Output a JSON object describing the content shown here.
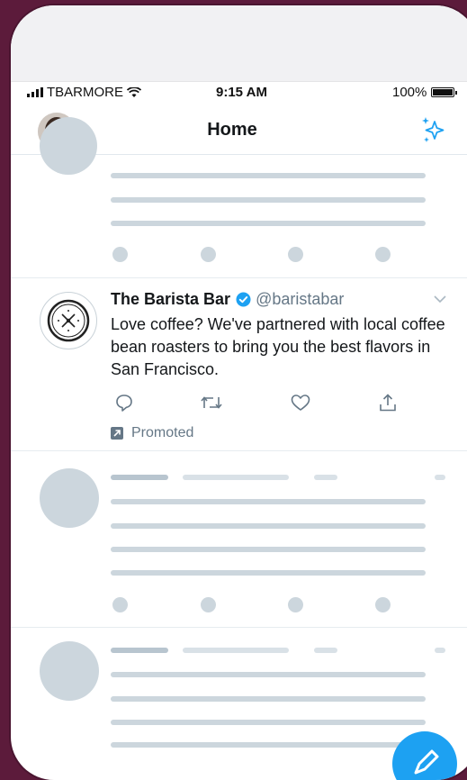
{
  "status_bar": {
    "carrier": "TBARMORE",
    "time": "9:15 AM",
    "battery": "100%"
  },
  "nav": {
    "title": "Home"
  },
  "ad": {
    "name": "The Barista Bar",
    "handle": "@baristabar",
    "text": "Love coffee? We've partnered with local coffee bean roasters to bring you the best flavors in San Francisco.",
    "promoted_label": "Promoted"
  },
  "icons": {
    "signal": "signal-bars-icon",
    "wifi": "wifi-icon",
    "battery": "battery-icon",
    "sparkle": "sparkle-icon",
    "verified": "verified-badge-icon",
    "caret": "chevron-down-icon",
    "reply": "reply-icon",
    "retweet": "retweet-icon",
    "like": "heart-icon",
    "share": "share-icon",
    "promoted": "promoted-arrow-icon"
  },
  "colors": {
    "background": "#5c1b3b",
    "accent": "#1da1f2",
    "placeholder": "#ccd6dd",
    "muted_text": "#657786",
    "text": "#14171a"
  }
}
